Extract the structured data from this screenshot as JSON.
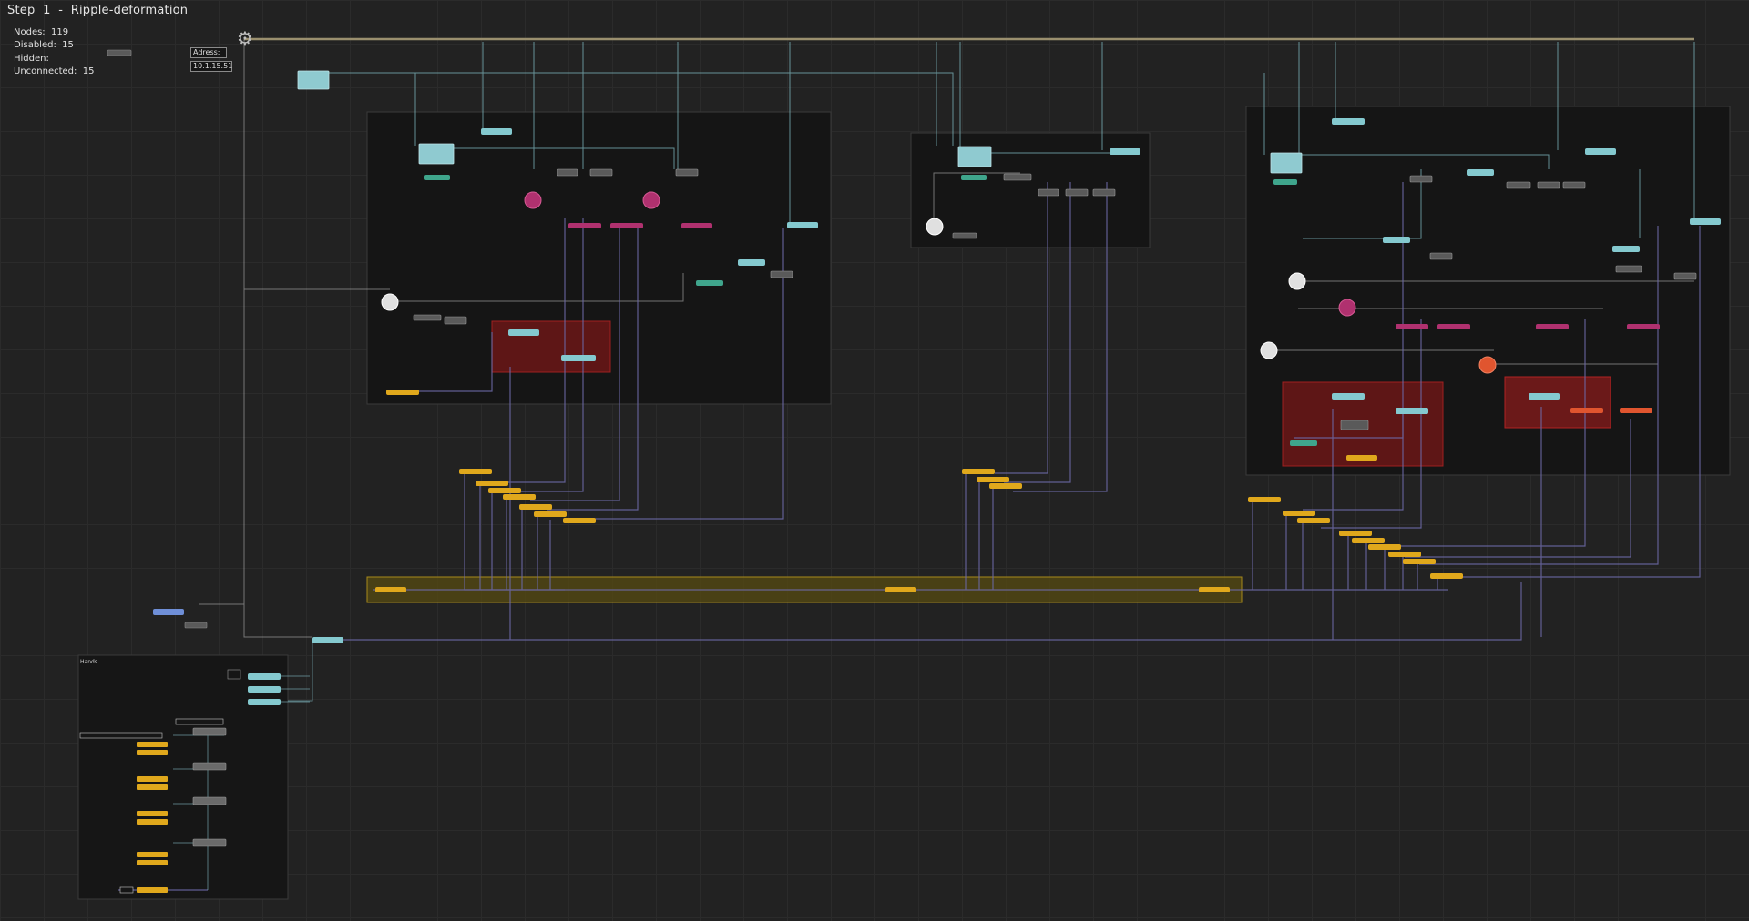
{
  "editor": {
    "step_title": "Step  1  -  Ripple-deformation",
    "stats": {
      "nodes_label": "Nodes:",
      "nodes_value": "119",
      "disabled_label": "Disabled:",
      "disabled_value": "15",
      "hidden_label": "Hidden:",
      "hidden_value": "",
      "unconnected_label": "Unconnected:",
      "unconnected_value": "15"
    },
    "address_label": "Adress:",
    "address_value": "10.1.15.51",
    "hands_group_label": "Hands"
  },
  "colors": {
    "background": "#222222",
    "wire_teal": "#7fb8c0",
    "wire_purple": "#6d6aa8",
    "wire_tan": "#9a8f6e",
    "node_teal": "#84c9cf",
    "node_yellow": "#e0a81c",
    "node_magenta": "#b0316f",
    "node_red_group": "#8a1c1c",
    "node_grey": "#7a7a7a",
    "node_orange": "#e0552f",
    "node_blue": "#6f8fd8",
    "node_green": "#3fa58c"
  },
  "icons": {
    "settings": "gear-icon",
    "drag_handle": "drag-handle-icon"
  }
}
